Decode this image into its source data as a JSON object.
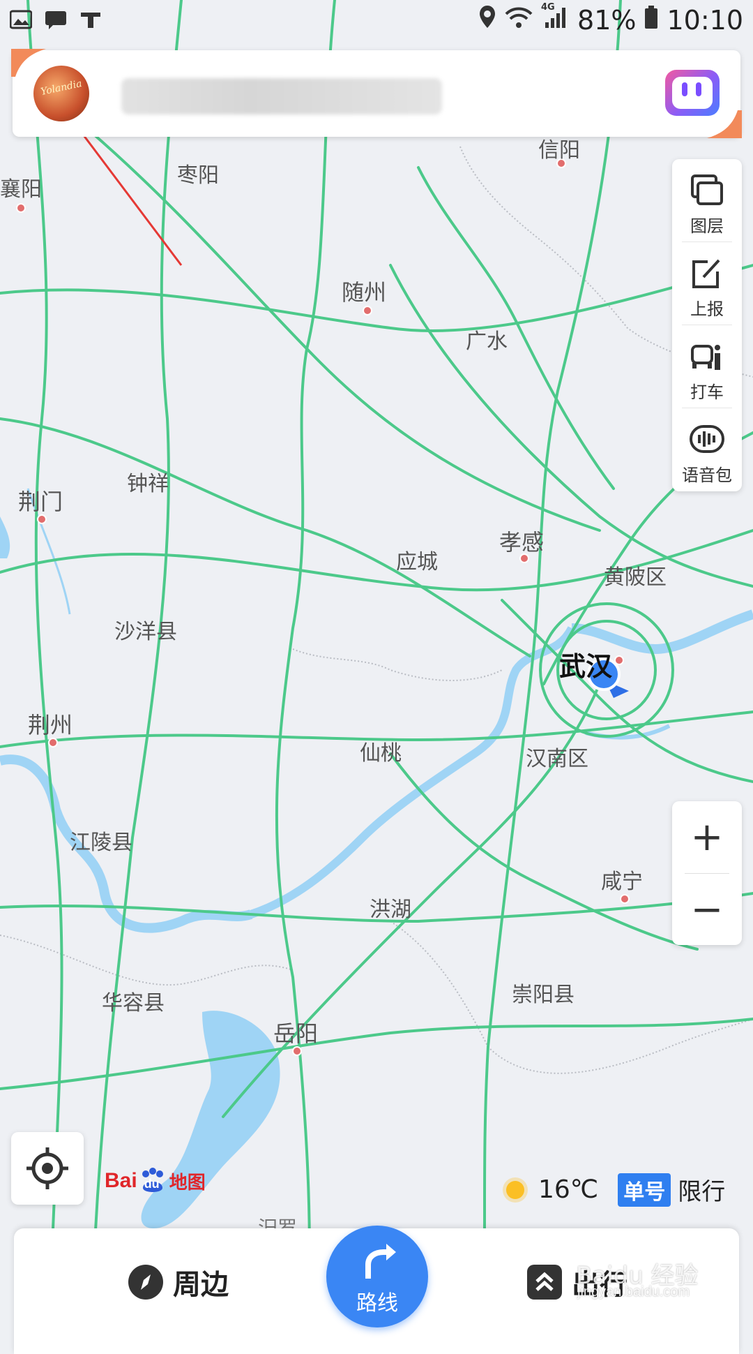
{
  "status_bar": {
    "battery": "81%",
    "time": "10:10",
    "network": "4G"
  },
  "search": {
    "avatar_text": "Yolandia"
  },
  "map": {
    "cities": [
      {
        "name": "襄阳"
      },
      {
        "name": "枣阳"
      },
      {
        "name": "信阳"
      },
      {
        "name": "随州"
      },
      {
        "name": "广水"
      },
      {
        "name": "钟祥"
      },
      {
        "name": "荆门"
      },
      {
        "name": "应城"
      },
      {
        "name": "孝感"
      },
      {
        "name": "黄陂区"
      },
      {
        "name": "沙洋县"
      },
      {
        "name": "武汉"
      },
      {
        "name": "荆州"
      },
      {
        "name": "仙桃"
      },
      {
        "name": "汉南区"
      },
      {
        "name": "江陵县"
      },
      {
        "name": "咸宁"
      },
      {
        "name": "洪湖"
      },
      {
        "name": "崇阳县"
      },
      {
        "name": "华容县"
      },
      {
        "name": "岳阳"
      },
      {
        "name": "汨罗"
      }
    ]
  },
  "toolbar": {
    "items": [
      {
        "label": "图层",
        "icon": "layers-icon"
      },
      {
        "label": "上报",
        "icon": "report-icon"
      },
      {
        "label": "打车",
        "icon": "taxi-icon"
      },
      {
        "label": "语音包",
        "icon": "voice-pack-icon"
      }
    ]
  },
  "zoom": {
    "in": "+",
    "out": "−"
  },
  "logo": {
    "latin_a": "Bai",
    "latin_b": "du",
    "cn": "地图"
  },
  "weather": {
    "temp": "16℃",
    "badge": "单号",
    "limit": "限行"
  },
  "bottom": {
    "nearby": "周边",
    "route": "路线",
    "travel": "出行"
  },
  "watermark": {
    "main": "Baidu 经验",
    "sub": "jingyan.baidu.com"
  },
  "colors": {
    "road": "#4cc98a",
    "water": "#9fd4f5",
    "accent": "#3a86f4"
  }
}
